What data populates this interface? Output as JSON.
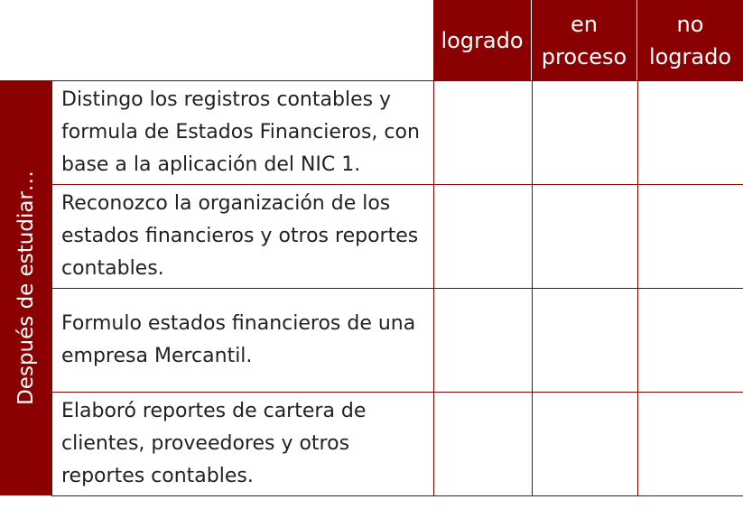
{
  "header": {
    "columns": [
      {
        "lines": [
          "logrado"
        ]
      },
      {
        "lines": [
          "en",
          "proceso"
        ]
      },
      {
        "lines": [
          "no",
          "logrado"
        ]
      }
    ]
  },
  "side_label": "Después de estudiar…",
  "rows": [
    {
      "text": "Distingo los registros contables y formula de Estados Financieros, con base a la aplicación del NIC 1."
    },
    {
      "text": "Reconozco la organización de los estados financieros y otros reportes contables."
    },
    {
      "text": "Formulo estados financieros de una empresa Mercantil."
    },
    {
      "text": "Elaboró reportes de cartera de clientes, proveedores y otros reportes contables."
    }
  ]
}
